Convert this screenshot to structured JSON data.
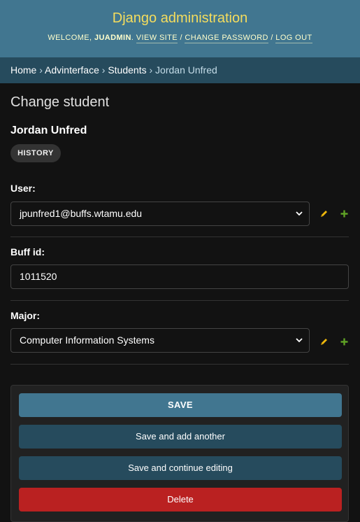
{
  "header": {
    "brand": "Django administration",
    "welcome_prefix": "Welcome, ",
    "username": "juadmin",
    "view_site": "View site",
    "change_password": "Change password",
    "log_out": "Log out",
    "separator": "/"
  },
  "breadcrumbs": {
    "items": [
      "Home",
      "Advinterface",
      "Students"
    ],
    "current": "Jordan Unfred",
    "arrow": "›"
  },
  "page": {
    "title": "Change student",
    "object_title": "Jordan Unfred",
    "history": "History"
  },
  "form": {
    "user": {
      "label": "User:",
      "value": "jpunfred1@buffs.wtamu.edu"
    },
    "buff_id": {
      "label": "Buff id:",
      "value": "1011520"
    },
    "major": {
      "label": "Major:",
      "value": "Computer Information Systems"
    }
  },
  "actions": {
    "save": "SAVE",
    "save_add": "Save and add another",
    "save_continue": "Save and continue editing",
    "delete": "Delete"
  },
  "icons": {
    "edit": "pencil-icon",
    "add": "plus-icon",
    "dropdown": "chevron-down-icon"
  },
  "colors": {
    "header_bg": "#417690",
    "brand": "#f5dd5d",
    "breadcrumbs_bg": "#264b5d",
    "save_bg": "#417690",
    "secondary_bg": "#264b5d",
    "delete_bg": "#ba2121",
    "edit_icon": "#efb80b",
    "add_icon": "#5fa225"
  }
}
